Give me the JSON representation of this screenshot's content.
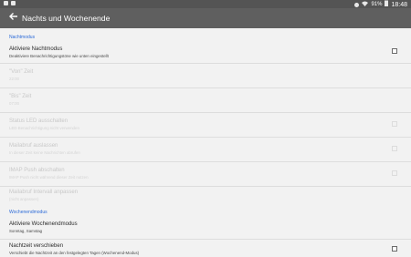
{
  "status_bar": {
    "time": "18:48",
    "battery": "91%",
    "left_icons": [
      "notification-icon-1",
      "notification-icon-2"
    ],
    "right_icons": [
      "location-icon",
      "wifi-icon",
      "battery-icon"
    ]
  },
  "app_bar": {
    "back_icon": "arrow-back-icon",
    "title": "Nachts und Wochenende"
  },
  "sections": {
    "night": {
      "header": "Nachtmodus",
      "items": [
        {
          "title": "Aktiviere Nachtmodus",
          "subtitle": "Deaktiviere Benachrichtigungstöne wie unten eingestellt",
          "enabled": true,
          "checked": false
        },
        {
          "title": "\"Von\" Zeit",
          "subtitle": "22:00",
          "enabled": false
        },
        {
          "title": "\"Bis\" Zeit",
          "subtitle": "07:00",
          "enabled": false
        },
        {
          "title": "Status LED ausschalten",
          "subtitle": "LED Benachrichtigung nicht verwenden",
          "enabled": false,
          "checked": false
        },
        {
          "title": "Mailabruf auslassen",
          "subtitle": "In dieser Zeit keine Nachrichten abrufen",
          "enabled": false,
          "checked": false
        },
        {
          "title": "IMAP Push abschalten",
          "subtitle": "IMAP Push nicht während dieser Zeit nutzen",
          "enabled": false,
          "checked": false
        },
        {
          "title": "Mailabruf Intervall anpassen",
          "subtitle": "(nicht anpassen)",
          "enabled": false
        }
      ]
    },
    "weekend": {
      "header": "Wochenendmodus",
      "items": [
        {
          "title": "Aktiviere Wochenendmodus",
          "subtitle": "Sonntag, Samstag",
          "enabled": true
        },
        {
          "title": "Nachtzeit verschieben",
          "subtitle": "Verschiebt die Nachtzeit an den festgelegten Tagen (Wochenend-Modus)",
          "enabled": true,
          "checked": false
        }
      ]
    }
  },
  "colors": {
    "status_bar": "#545454",
    "app_bar": "#5f5f5f",
    "background": "#f2f2f2",
    "section_header": "#2d6bd8",
    "divider": "#dddddd"
  }
}
